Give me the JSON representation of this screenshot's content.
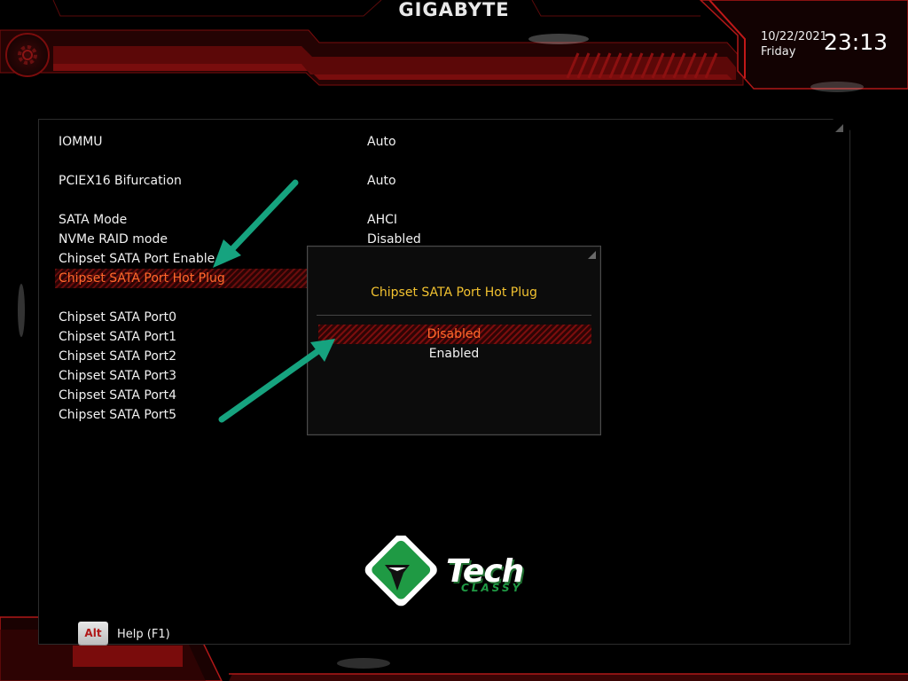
{
  "header": {
    "brand": "GIGABYTE",
    "date": "10/22/2021",
    "day": "Friday",
    "time": "23:13",
    "settings_icon": "gear-icon"
  },
  "settings": [
    {
      "label": "IOMMU",
      "value": "Auto"
    },
    {
      "label": "PCIEX16 Bifurcation",
      "value": "Auto"
    },
    {
      "label": "SATA Mode",
      "value": "AHCI"
    },
    {
      "label": "NVMe RAID mode",
      "value": "Disabled"
    },
    {
      "label": "Chipset SATA Port Enable",
      "value": ""
    },
    {
      "label": "Chipset SATA Port Hot Plug",
      "value": ""
    },
    {
      "label": "Chipset SATA Port0",
      "value": ""
    },
    {
      "label": "Chipset SATA Port1",
      "value": ""
    },
    {
      "label": "Chipset SATA Port2",
      "value": ""
    },
    {
      "label": "Chipset SATA Port3",
      "value": ""
    },
    {
      "label": "Chipset SATA Port4",
      "value": ""
    },
    {
      "label": "Chipset SATA Port5",
      "value": ""
    }
  ],
  "popup": {
    "title": "Chipset SATA Port Hot Plug",
    "options": [
      "Disabled",
      "Enabled"
    ],
    "selected": "Disabled"
  },
  "logo": {
    "main": "Tech",
    "sub": "CLASSY"
  },
  "footer": {
    "key": "Alt",
    "help": "Help (F1)"
  },
  "colors": {
    "accent_red": "#b01818",
    "selected_text": "#ff6a2b",
    "popup_title": "#f2c230",
    "arrow": "#16a37f",
    "logo_green": "#1f9a44"
  }
}
